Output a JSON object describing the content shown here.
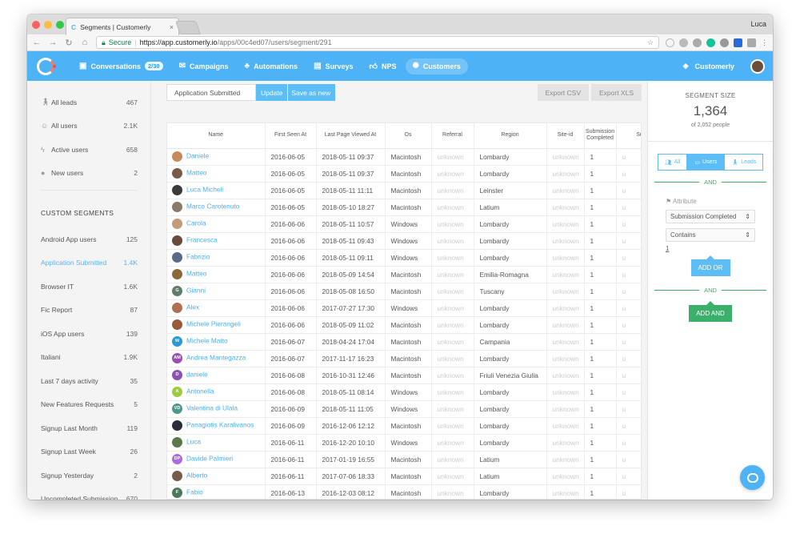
{
  "browser": {
    "tab_title": "Segments | Customerly",
    "tab_close": "×",
    "profile": "Luca",
    "secure_label": "Secure",
    "url_host": "https://app.customerly.io",
    "url_path": "/apps/00c4ed07/users/segment/291"
  },
  "nav": {
    "items": [
      {
        "label": "Conversations",
        "badge": "2/30",
        "icon": "conversations-icon"
      },
      {
        "label": "Campaigns",
        "icon": "campaigns-icon"
      },
      {
        "label": "Automations",
        "icon": "automations-icon"
      },
      {
        "label": "Surveys",
        "icon": "surveys-icon"
      },
      {
        "label": "NPS",
        "icon": "nps-icon"
      },
      {
        "label": "Customers",
        "icon": "customers-icon"
      }
    ],
    "workspace": "Customerly"
  },
  "sidebar": {
    "top": [
      {
        "label": "All leads",
        "count": "467"
      },
      {
        "label": "All users",
        "count": "2.1K"
      },
      {
        "label": "Active users",
        "count": "658"
      },
      {
        "label": "New users",
        "count": "2"
      }
    ],
    "heading": "CUSTOM SEGMENTS",
    "segments": [
      {
        "label": "Android App users",
        "count": "125"
      },
      {
        "label": "Application Submitted",
        "count": "1.4K"
      },
      {
        "label": "Browser IT",
        "count": "1.6K"
      },
      {
        "label": "Fic Report",
        "count": "87"
      },
      {
        "label": "iOS App users",
        "count": "139"
      },
      {
        "label": "Italiani",
        "count": "1.9K"
      },
      {
        "label": "Last 7 days activity",
        "count": "35"
      },
      {
        "label": "New Features Requests",
        "count": "5"
      },
      {
        "label": "Signup Last Month",
        "count": "119"
      },
      {
        "label": "Signup Last Week",
        "count": "26"
      },
      {
        "label": "Signup Yesterday",
        "count": "2"
      },
      {
        "label": "Uncompleted Submission",
        "count": "670"
      }
    ]
  },
  "segment": {
    "name": "Application Submitted",
    "update": "Update",
    "save_as_new": "Save as new",
    "export_csv": "Export CSV",
    "export_xls": "Export XLS"
  },
  "table": {
    "headers": [
      "Name",
      "First Seen At",
      "Last Page Viewed At",
      "Os",
      "Referral",
      "Region",
      "Site-id",
      "Submission Completed",
      "Su"
    ],
    "rows": [
      {
        "initials": "",
        "color": "#c98a5a",
        "name": "Daniele",
        "first": "2016-06-05",
        "last": "2018-05-11 09:37",
        "os": "Macintosh",
        "ref": "unknown",
        "region": "Lombardy",
        "site": "unknown",
        "sub": "1",
        "su": "u"
      },
      {
        "initials": "",
        "color": "#7a5a48",
        "name": "Matteo",
        "first": "2016-06-05",
        "last": "2018-05-11 09:37",
        "os": "Macintosh",
        "ref": "unknown",
        "region": "Lombardy",
        "site": "unknown",
        "sub": "1",
        "su": "u"
      },
      {
        "initials": "",
        "color": "#3a3a3a",
        "name": "Luca Micheli",
        "first": "2016-06-05",
        "last": "2018-05-11 11:11",
        "os": "Macintosh",
        "ref": "unknown",
        "region": "Leinster",
        "site": "unknown",
        "sub": "1",
        "su": "u"
      },
      {
        "initials": "",
        "color": "#8a7a6a",
        "name": "Marco Carotenuto",
        "first": "2016-06-05",
        "last": "2018-05-10 18:27",
        "os": "Macintosh",
        "ref": "unknown",
        "region": "Latium",
        "site": "unknown",
        "sub": "1",
        "su": "u"
      },
      {
        "initials": "",
        "color": "#c49a7a",
        "name": "Carola",
        "first": "2016-06-06",
        "last": "2018-05-11 10:57",
        "os": "Windows",
        "ref": "unknown",
        "region": "Lombardy",
        "site": "unknown",
        "sub": "1",
        "su": "u"
      },
      {
        "initials": "",
        "color": "#6a4a3a",
        "name": "Francesca",
        "first": "2016-06-06",
        "last": "2018-05-11 09:43",
        "os": "Windows",
        "ref": "unknown",
        "region": "Lombardy",
        "site": "unknown",
        "sub": "1",
        "su": "u"
      },
      {
        "initials": "",
        "color": "#5a6a8a",
        "name": "Fabrizio",
        "first": "2016-06-06",
        "last": "2018-05-11 09:11",
        "os": "Windows",
        "ref": "unknown",
        "region": "Lombardy",
        "site": "unknown",
        "sub": "1",
        "su": "u"
      },
      {
        "initials": "",
        "color": "#8a6a3a",
        "name": "Matteo",
        "first": "2016-06-06",
        "last": "2018-05-09 14:54",
        "os": "Macintosh",
        "ref": "unknown",
        "region": "Emilia-Romagna",
        "site": "unknown",
        "sub": "1",
        "su": "u"
      },
      {
        "initials": "G",
        "color": "#607d6b",
        "name": "Gianni",
        "first": "2016-06-06",
        "last": "2018-05-08 16:50",
        "os": "Macintosh",
        "ref": "unknown",
        "region": "Tuscany",
        "site": "unknown",
        "sub": "1",
        "su": "u"
      },
      {
        "initials": "",
        "color": "#b07050",
        "name": "Alex",
        "first": "2016-06-06",
        "last": "2017-07-27 17:30",
        "os": "Windows",
        "ref": "unknown",
        "region": "Lombardy",
        "site": "unknown",
        "sub": "1",
        "su": "u"
      },
      {
        "initials": "",
        "color": "#9a5a3a",
        "name": "Michele Pierangeli",
        "first": "2016-06-06",
        "last": "2018-05-09 11:02",
        "os": "Macintosh",
        "ref": "unknown",
        "region": "Lombardy",
        "site": "unknown",
        "sub": "1",
        "su": "u"
      },
      {
        "initials": "W",
        "color": "#2a9ad8",
        "name": "Michele Matto",
        "first": "2016-06-07",
        "last": "2018-04-24 17:04",
        "os": "Macintosh",
        "ref": "unknown",
        "region": "Campania",
        "site": "unknown",
        "sub": "1",
        "su": "u"
      },
      {
        "initials": "AM",
        "color": "#9c4fb0",
        "name": "Andrea Mantegazza",
        "first": "2016-06-07",
        "last": "2017-11-17 16:23",
        "os": "Macintosh",
        "ref": "unknown",
        "region": "Lombardy",
        "site": "unknown",
        "sub": "1",
        "su": "u"
      },
      {
        "initials": "D",
        "color": "#8e4fb8",
        "name": "daniele",
        "first": "2016-06-08",
        "last": "2016-10-31 12:46",
        "os": "Macintosh",
        "ref": "unknown",
        "region": "Friuli Venezia Giulia",
        "site": "unknown",
        "sub": "1",
        "su": "u"
      },
      {
        "initials": "A",
        "color": "#9ccc3c",
        "name": "Antonella",
        "first": "2016-06-08",
        "last": "2018-05-11 08:14",
        "os": "Windows",
        "ref": "unknown",
        "region": "Lombardy",
        "site": "unknown",
        "sub": "1",
        "su": "u"
      },
      {
        "initials": "VD",
        "color": "#4a9a8a",
        "name": "Valentina di Ulala",
        "first": "2016-06-09",
        "last": "2018-05-11 11:05",
        "os": "Windows",
        "ref": "unknown",
        "region": "Lombardy",
        "site": "unknown",
        "sub": "1",
        "su": "u"
      },
      {
        "initials": "",
        "color": "#2a2a3a",
        "name": "Panagiotis Karalivanos",
        "first": "2016-06-09",
        "last": "2016-12-06 12:12",
        "os": "Macintosh",
        "ref": "unknown",
        "region": "Lombardy",
        "site": "unknown",
        "sub": "1",
        "su": "u"
      },
      {
        "initials": "",
        "color": "#5a7a4a",
        "name": "Luca",
        "first": "2016-06-11",
        "last": "2016-12-20 10:10",
        "os": "Windows",
        "ref": "unknown",
        "region": "Lombardy",
        "site": "unknown",
        "sub": "1",
        "su": "u"
      },
      {
        "initials": "DP",
        "color": "#b06ae0",
        "name": "Davide Palmieri",
        "first": "2016-06-11",
        "last": "2017-01-19 16:55",
        "os": "Macintosh",
        "ref": "unknown",
        "region": "Latium",
        "site": "unknown",
        "sub": "1",
        "su": "u"
      },
      {
        "initials": "",
        "color": "#7a5a4a",
        "name": "Alberto",
        "first": "2016-06-11",
        "last": "2017-07-06 18:33",
        "os": "Macintosh",
        "ref": "unknown",
        "region": "Latium",
        "site": "unknown",
        "sub": "1",
        "su": "u"
      },
      {
        "initials": "F",
        "color": "#4a7a5a",
        "name": "Fabio",
        "first": "2016-06-13",
        "last": "2016-12-03 08:12",
        "os": "Macintosh",
        "ref": "unknown",
        "region": "Lombardy",
        "site": "unknown",
        "sub": "1",
        "su": "u"
      }
    ]
  },
  "panel": {
    "size_label": "SEGMENT SIZE",
    "size": "1,364",
    "of": "of 2,052 people",
    "filter_all": "All",
    "filter_users": "Users",
    "filter_leads": "Leads",
    "and": "AND",
    "attribute_label": "Attribute",
    "attribute_value": "Submission Completed",
    "operator_value": "Contains",
    "value": "1",
    "add_or": "ADD OR",
    "add_and": "ADD AND"
  },
  "colors": {
    "accent": "#4db3f6",
    "green": "#3bb06b"
  }
}
